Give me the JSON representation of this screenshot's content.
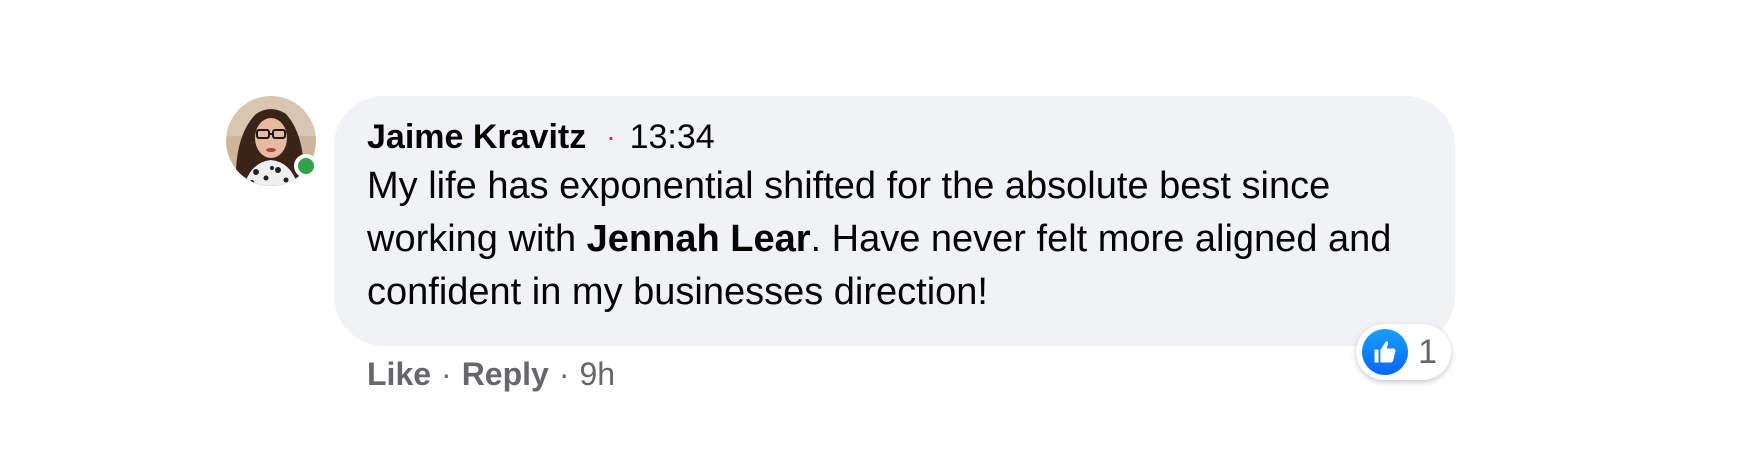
{
  "comment": {
    "author": "Jaime Kravitz",
    "separator": "·",
    "timestamp": "13:34",
    "text_before": "My life has exponential shifted for the absolute best since working with ",
    "mention": "Jennah Lear",
    "text_after": ". Have never felt more aligned and confident in my businesses direction!",
    "avatar_icon": "user-avatar-photo",
    "online_status_color": "#31a24c"
  },
  "reactions": {
    "icon": "thumbs-up-icon",
    "count": "1",
    "color": "#0866ff"
  },
  "actions": {
    "like_label": "Like",
    "dot1": "·",
    "reply_label": "Reply",
    "dot2": "·",
    "age": "9h"
  }
}
